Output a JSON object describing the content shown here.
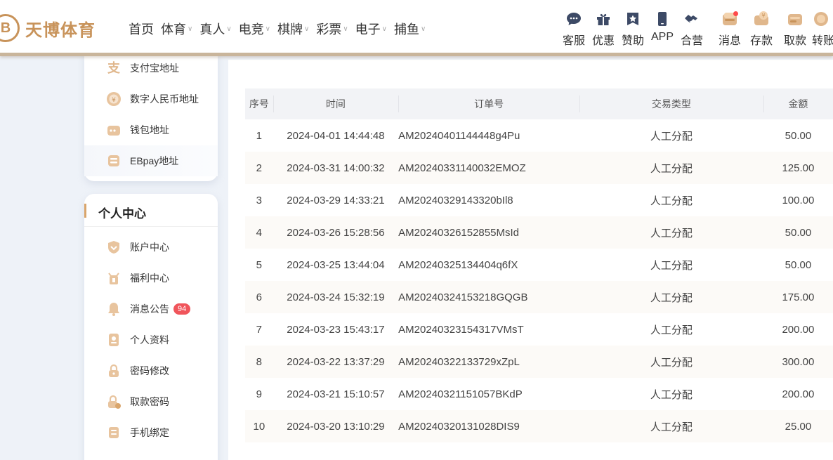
{
  "brand": {
    "logo_mark": "B",
    "name": "天博体育"
  },
  "nav": [
    {
      "label": "首页",
      "has_dropdown": false
    },
    {
      "label": "体育",
      "has_dropdown": true
    },
    {
      "label": "真人",
      "has_dropdown": true
    },
    {
      "label": "电竞",
      "has_dropdown": true
    },
    {
      "label": "棋牌",
      "has_dropdown": true
    },
    {
      "label": "彩票",
      "has_dropdown": true
    },
    {
      "label": "电子",
      "has_dropdown": true
    },
    {
      "label": "捕鱼",
      "has_dropdown": true
    }
  ],
  "tools": [
    {
      "label": "客服",
      "icon": "chat-bubble-icon"
    },
    {
      "label": "优惠",
      "icon": "gift-icon"
    },
    {
      "label": "赞助",
      "icon": "star-badge-icon"
    },
    {
      "label": "APP",
      "icon": "phone-icon"
    },
    {
      "label": "合营",
      "icon": "handshake-icon"
    },
    {
      "label": "消息",
      "icon": "message-box-icon"
    },
    {
      "label": "存款",
      "icon": "deposit-icon"
    },
    {
      "label": "取款",
      "icon": "withdraw-icon"
    },
    {
      "label": "转账",
      "icon": "transfer-icon"
    }
  ],
  "sidebar_top": [
    {
      "label": "支付宝地址",
      "icon": "alipay-icon"
    },
    {
      "label": "数字人民币地址",
      "icon": "digital-rmb-icon"
    },
    {
      "label": "钱包地址",
      "icon": "wallet-icon"
    },
    {
      "label": "EBpay地址",
      "icon": "ebpay-icon"
    }
  ],
  "personal": {
    "title": "个人中心",
    "items": [
      {
        "label": "账户中心",
        "icon": "shield-icon"
      },
      {
        "label": "福利中心",
        "icon": "welfare-icon"
      },
      {
        "label": "消息公告",
        "icon": "bell-icon",
        "badge": "94"
      },
      {
        "label": "个人资料",
        "icon": "profile-icon"
      },
      {
        "label": "密码修改",
        "icon": "lock-icon"
      },
      {
        "label": "取款密码",
        "icon": "withdraw-lock-icon"
      },
      {
        "label": "手机绑定",
        "icon": "phone-bind-icon"
      }
    ]
  },
  "table": {
    "headers": [
      "序号",
      "时间",
      "订单号",
      "交易类型",
      "金额"
    ],
    "rows": [
      {
        "no": "1",
        "time": "2024-04-01 14:44:48",
        "order": "AM20240401144448g4Pu",
        "type": "人工分配",
        "amount": "50.00"
      },
      {
        "no": "2",
        "time": "2024-03-31 14:00:32",
        "order": "AM20240331140032EMOZ",
        "type": "人工分配",
        "amount": "125.00"
      },
      {
        "no": "3",
        "time": "2024-03-29 14:33:21",
        "order": "AM20240329143320bIl8",
        "type": "人工分配",
        "amount": "100.00"
      },
      {
        "no": "4",
        "time": "2024-03-26 15:28:56",
        "order": "AM20240326152855MsId",
        "type": "人工分配",
        "amount": "50.00"
      },
      {
        "no": "5",
        "time": "2024-03-25 13:44:04",
        "order": "AM20240325134404q6fX",
        "type": "人工分配",
        "amount": "50.00"
      },
      {
        "no": "6",
        "time": "2024-03-24 15:32:19",
        "order": "AM20240324153218GQGB",
        "type": "人工分配",
        "amount": "175.00"
      },
      {
        "no": "7",
        "time": "2024-03-23 15:43:17",
        "order": "AM20240323154317VMsT",
        "type": "人工分配",
        "amount": "200.00"
      },
      {
        "no": "8",
        "time": "2024-03-22 13:37:29",
        "order": "AM20240322133729xZpL",
        "type": "人工分配",
        "amount": "300.00"
      },
      {
        "no": "9",
        "time": "2024-03-21 15:10:57",
        "order": "AM20240321151057BKdP",
        "type": "人工分配",
        "amount": "200.00"
      },
      {
        "no": "10",
        "time": "2024-03-20 13:10:29",
        "order": "AM20240320131028DIS9",
        "type": "人工分配",
        "amount": "25.00"
      }
    ]
  },
  "colors": {
    "brand_gold": "#c8935a",
    "badge_red": "#f0555b",
    "nav_icon": "#3d4a66"
  }
}
